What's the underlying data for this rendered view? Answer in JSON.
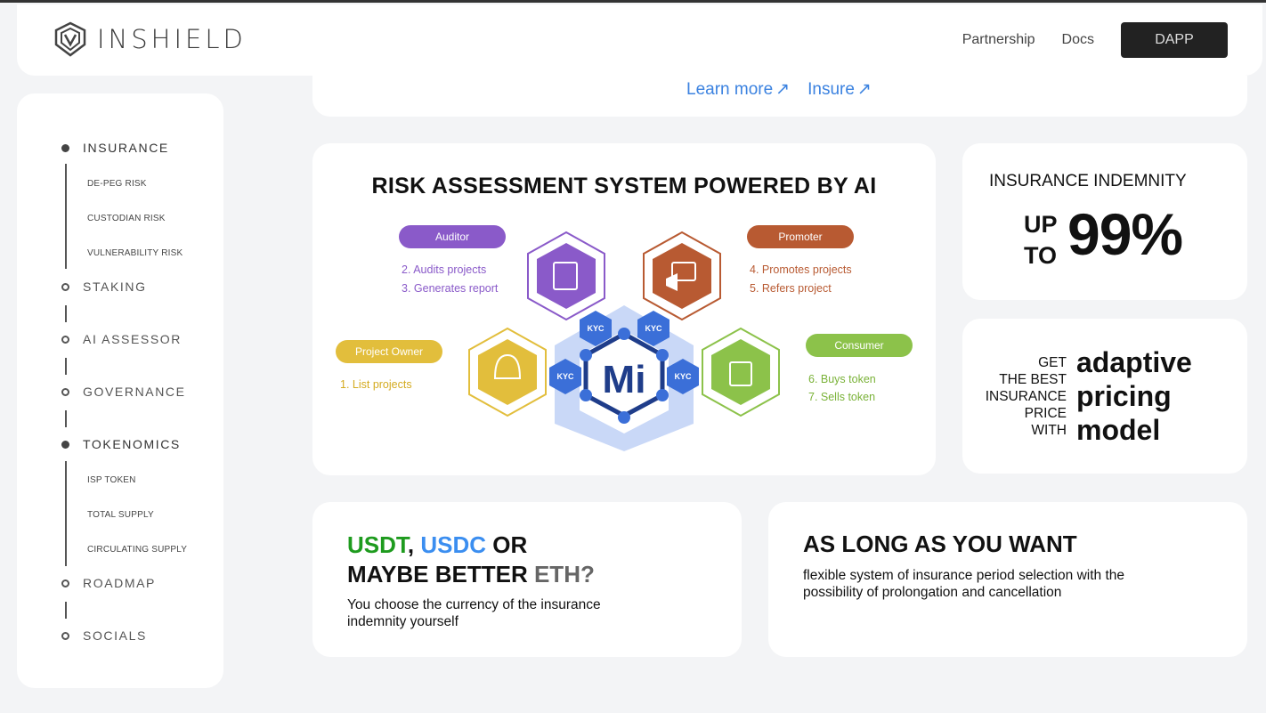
{
  "header": {
    "logo_text": "INSHIELD",
    "nav": {
      "partnership": "Partnership",
      "docs": "Docs",
      "dapp": "DAPP"
    }
  },
  "sidebar": {
    "sections": [
      {
        "label": "INSURANCE",
        "state": "active"
      },
      {
        "label": "STAKING",
        "state": "inactive"
      },
      {
        "label": "AI ASSESSOR",
        "state": "inactive"
      },
      {
        "label": "GOVERNANCE",
        "state": "inactive"
      },
      {
        "label": "TOKENOMICS",
        "state": "active"
      },
      {
        "label": "ROADMAP",
        "state": "inactive"
      },
      {
        "label": "SOCIALS",
        "state": "inactive"
      }
    ],
    "insurance_sub": [
      "DE-PEG RISK",
      "CUSTODIAN RISK",
      "VULNERABILITY RISK"
    ],
    "tokenomics_sub": [
      "ISP TOKEN",
      "TOTAL SUPPLY",
      "CIRCULATING SUPPLY"
    ]
  },
  "top_links": {
    "learn_more": "Learn more",
    "insure": "Insure",
    "arrow": "↗"
  },
  "risk": {
    "title": "RISK ASSESSMENT SYSTEM POWERED BY AI",
    "roles": {
      "auditor": {
        "label": "Auditor",
        "items": [
          "2.  Audits projects",
          "3.  Generates report"
        ]
      },
      "promoter": {
        "label": "Promoter",
        "items": [
          "4.  Promotes projects",
          "5.  Refers project"
        ]
      },
      "project_owner": {
        "label": "Project Owner",
        "items": [
          "1.    List projects"
        ]
      },
      "consumer": {
        "label": "Consumer",
        "items": [
          "6.  Buys token",
          "7.  Sells token"
        ]
      }
    },
    "kyc": "KYC",
    "center_mark": "Mi",
    "colors": {
      "auditor": "#8a5ac9",
      "promoter": "#b85a32",
      "owner": "#e2be3c",
      "consumer": "#8cc24a",
      "kyc": "#3b6fd8"
    }
  },
  "indemnity": {
    "title": "INSURANCE INDEMNITY",
    "up": "UP",
    "to": "TO",
    "value": "99%"
  },
  "pricing": {
    "small": [
      "GET",
      "THE BEST",
      "INSURANCE",
      "PRICE",
      "WITH"
    ],
    "big": [
      "adaptive",
      "pricing",
      "model"
    ]
  },
  "currency": {
    "usdt": "USDT",
    "comma": ",",
    "usdc": "USDC",
    "or": " OR",
    "line2": "MAYBE BETTER ",
    "eth": "ETH?",
    "desc": "You choose the currency of the insurance indemnity yourself"
  },
  "period": {
    "title": "AS LONG AS YOU WANT",
    "desc": "flexible system of insurance period selection with the possibility of prolongation and cancellation"
  }
}
